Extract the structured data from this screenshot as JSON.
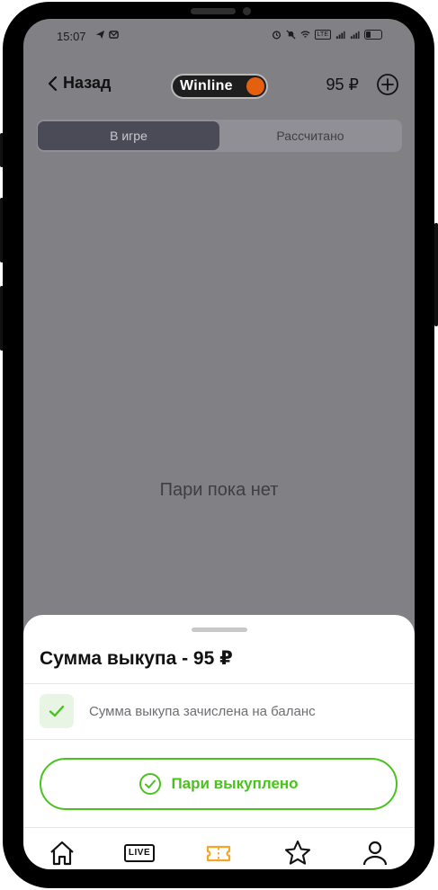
{
  "status_bar": {
    "time": "15:07",
    "network": "LTE"
  },
  "header": {
    "back_label": "Назад",
    "brand": "Winline",
    "balance": "95 ₽"
  },
  "tabs": [
    {
      "label": "В игре",
      "active": true
    },
    {
      "label": "Рассчитано",
      "active": false
    }
  ],
  "empty_state": "Пари пока нет",
  "sheet": {
    "title": "Сумма выкупа - 95 ₽",
    "notice": "Сумма выкупа зачислена на баланс",
    "cta_label": "Пари выкуплено"
  },
  "nav": {
    "live_label": "LIVE"
  },
  "colors": {
    "accent_green": "#49c21d",
    "brand_orange": "#e4600f",
    "active_nav": "#f5a623"
  }
}
